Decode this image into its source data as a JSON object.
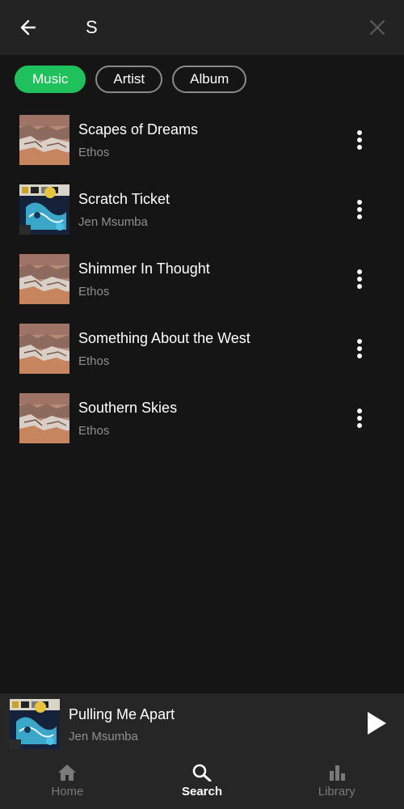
{
  "search": {
    "value": "S",
    "placeholder": ""
  },
  "filters": [
    {
      "label": "Music",
      "active": true
    },
    {
      "label": "Artist",
      "active": false
    },
    {
      "label": "Album",
      "active": false
    }
  ],
  "results": [
    {
      "title": "Scapes of Dreams",
      "artist": "Ethos",
      "art": "canyon"
    },
    {
      "title": "Scratch Ticket",
      "artist": "Jen Msumba",
      "art": "collage"
    },
    {
      "title": "Shimmer In Thought",
      "artist": "Ethos",
      "art": "canyon"
    },
    {
      "title": "Something About the West",
      "artist": "Ethos",
      "art": "canyon"
    },
    {
      "title": "Southern Skies",
      "artist": "Ethos",
      "art": "canyon"
    }
  ],
  "now_playing": {
    "title": "Pulling Me Apart",
    "artist": "Jen Msumba"
  },
  "nav": {
    "home": "Home",
    "search": "Search",
    "library": "Library"
  },
  "colors": {
    "accent": "#1fc15c",
    "background": "#151515",
    "surface": "#232323"
  }
}
